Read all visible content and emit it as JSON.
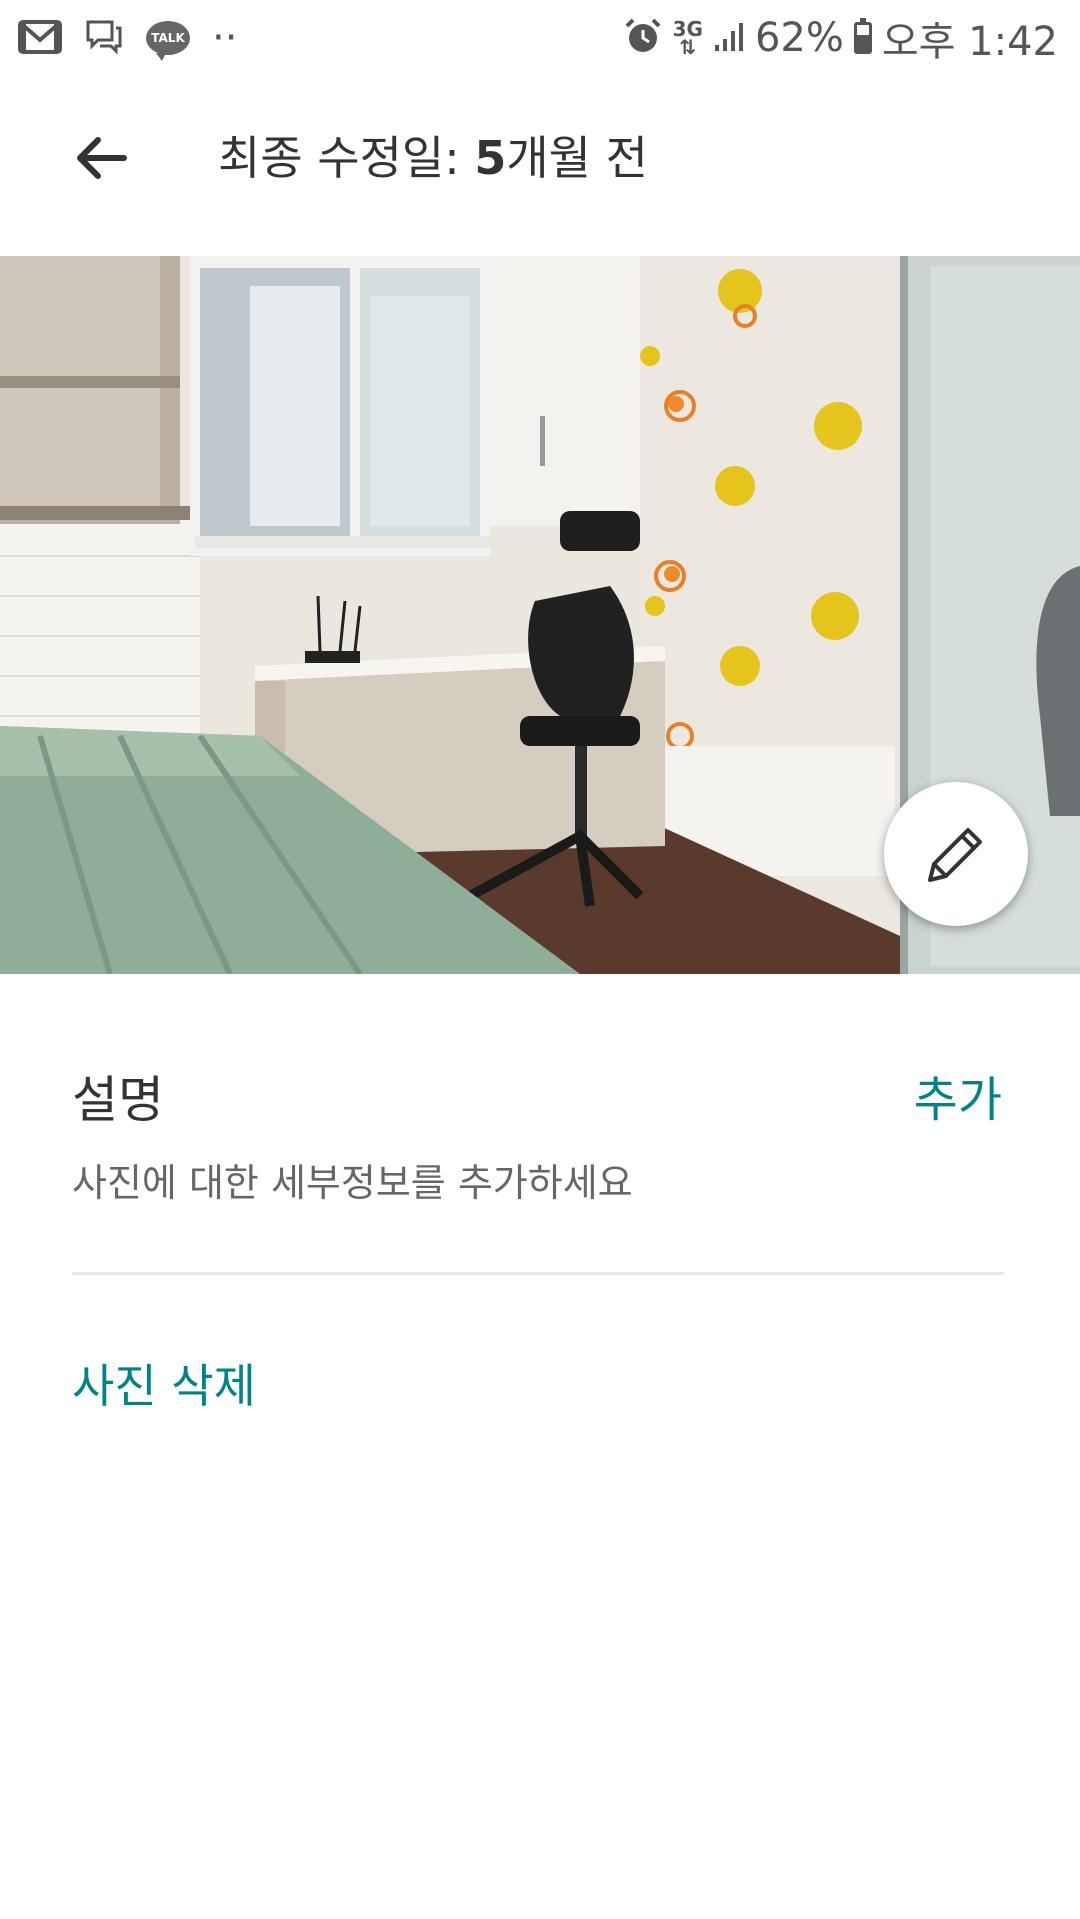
{
  "status_bar": {
    "icons_left": [
      "gmail-icon",
      "chat-bubble-icon",
      "kakaotalk-icon",
      "more-dots-icon"
    ],
    "talk_label": "TALK",
    "dots": "··",
    "network_top": "3G",
    "network_bottom": "⇅",
    "battery_percent": "62%",
    "battery_level": 0.62,
    "time": "오후 1:42"
  },
  "app_bar": {
    "title_prefix": "최종 수정일: ",
    "title_bold": "5",
    "title_suffix": "개월 전"
  },
  "description": {
    "title": "설명",
    "add_label": "추가",
    "placeholder": "사진에 대한 세부정보를 추가하세요"
  },
  "actions": {
    "delete_label": "사진 삭제"
  },
  "colors": {
    "accent": "#008489",
    "text_primary": "#333333",
    "text_secondary": "#666666"
  }
}
